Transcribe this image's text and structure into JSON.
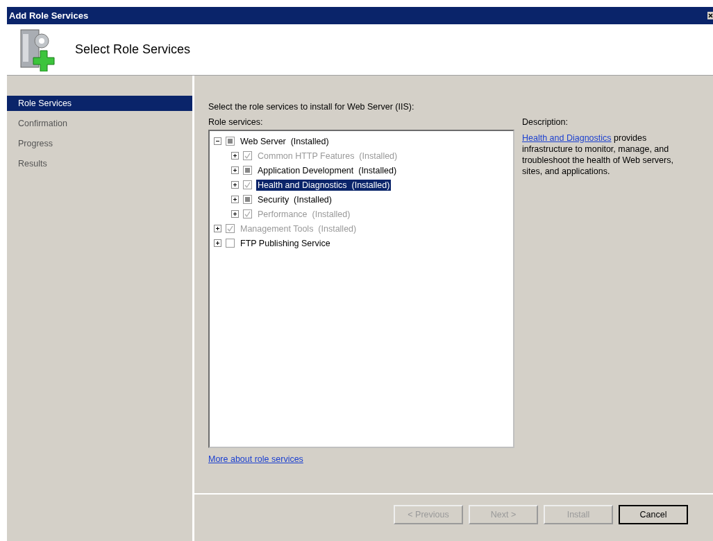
{
  "window": {
    "title": "Add Role Services"
  },
  "header": {
    "title": "Select Role Services"
  },
  "steps": [
    {
      "label": "Role Services",
      "selected": true
    },
    {
      "label": "Confirmation",
      "selected": false
    },
    {
      "label": "Progress",
      "selected": false
    },
    {
      "label": "Results",
      "selected": false
    }
  ],
  "instruction": "Select the role services to install for Web Server (IIS):",
  "tree_label": "Role services:",
  "tree": [
    {
      "label": "Web Server  (Installed)",
      "checked": false,
      "partial": true,
      "disabled": false,
      "selected": false,
      "expanded": true,
      "children": [
        {
          "label": "Common HTTP Features  (Installed)",
          "checked": true,
          "partial": false,
          "disabled": true,
          "selected": false,
          "expanded": false
        },
        {
          "label": "Application Development  (Installed)",
          "checked": false,
          "partial": true,
          "disabled": false,
          "selected": false,
          "expanded": false
        },
        {
          "label": "Health and Diagnostics  (Installed)",
          "checked": true,
          "partial": false,
          "disabled": true,
          "selected": true,
          "expanded": false
        },
        {
          "label": "Security  (Installed)",
          "checked": false,
          "partial": true,
          "disabled": false,
          "selected": false,
          "expanded": false
        },
        {
          "label": "Performance  (Installed)",
          "checked": true,
          "partial": false,
          "disabled": true,
          "selected": false,
          "expanded": false
        }
      ]
    },
    {
      "label": "Management Tools  (Installed)",
      "checked": true,
      "partial": false,
      "disabled": true,
      "selected": false,
      "expanded": false
    },
    {
      "label": "FTP Publishing Service",
      "checked": false,
      "partial": false,
      "disabled": false,
      "selected": false,
      "expanded": false
    }
  ],
  "description": {
    "label": "Description:",
    "link": "Health and Diagnostics",
    "text": " provides infrastructure to monitor, manage, and troubleshoot the health of Web servers, sites, and applications."
  },
  "more_link": "More about role services",
  "buttons": [
    {
      "label": "< Previous",
      "disabled": true,
      "default": false
    },
    {
      "label": "Next >",
      "disabled": true,
      "default": false
    },
    {
      "label": "Install",
      "disabled": true,
      "default": false
    },
    {
      "label": "Cancel",
      "disabled": false,
      "default": true
    }
  ]
}
